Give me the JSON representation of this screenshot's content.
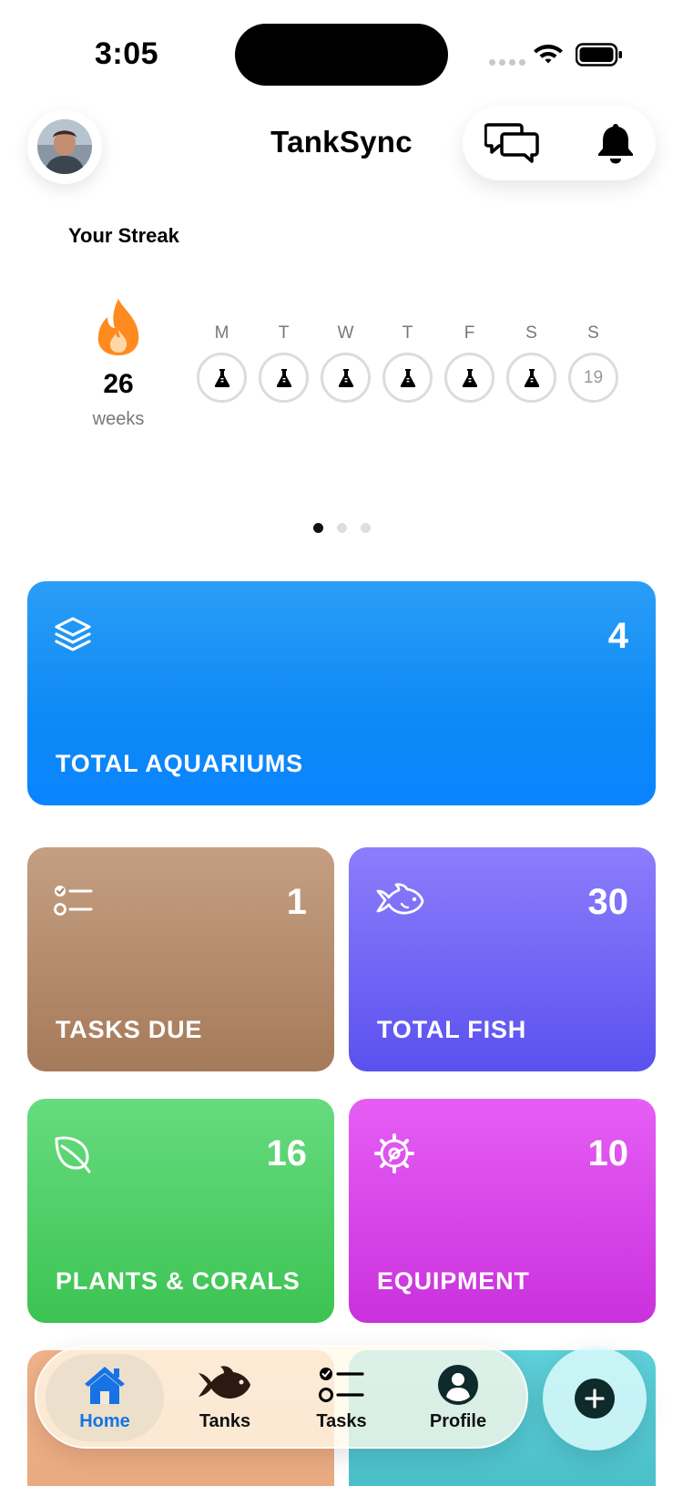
{
  "status_bar": {
    "time": "3:05"
  },
  "header": {
    "title": "TankSync",
    "avatar_icon": "avatar-photo",
    "chat_icon": "chat-bubbles-icon",
    "bell_icon": "bell-icon"
  },
  "streak": {
    "label": "Your Streak",
    "count": "26",
    "unit": "weeks",
    "days": [
      {
        "letter": "M",
        "state": "done"
      },
      {
        "letter": "T",
        "state": "done"
      },
      {
        "letter": "W",
        "state": "done"
      },
      {
        "letter": "T",
        "state": "done"
      },
      {
        "letter": "F",
        "state": "done"
      },
      {
        "letter": "S",
        "state": "done"
      },
      {
        "letter": "S",
        "state": "date",
        "date": "19"
      }
    ]
  },
  "pager": {
    "count": 3,
    "active": 0
  },
  "cards": {
    "aquariums": {
      "value": "4",
      "label": "TOTAL AQUARIUMS",
      "icon": "layers-icon"
    },
    "tasks": {
      "value": "1",
      "label": "TASKS DUE",
      "icon": "checklist-icon"
    },
    "fish": {
      "value": "30",
      "label": "TOTAL FISH",
      "icon": "fish-icon"
    },
    "plants": {
      "value": "16",
      "label": "PLANTS & CORALS",
      "icon": "leaf-icon"
    },
    "equipment": {
      "value": "10",
      "label": "EQUIPMENT",
      "icon": "gear-icon"
    }
  },
  "tabs": {
    "home": "Home",
    "tanks": "Tanks",
    "tasks": "Tasks",
    "profile": "Profile"
  },
  "colors": {
    "accent": "#1673e6",
    "aquariums": "#0a84ff",
    "tasks": "#a57a5a",
    "fish": "#5a52ef",
    "plants": "#3cc352",
    "equipment": "#c931dc",
    "flame": "#ff8a1f"
  }
}
